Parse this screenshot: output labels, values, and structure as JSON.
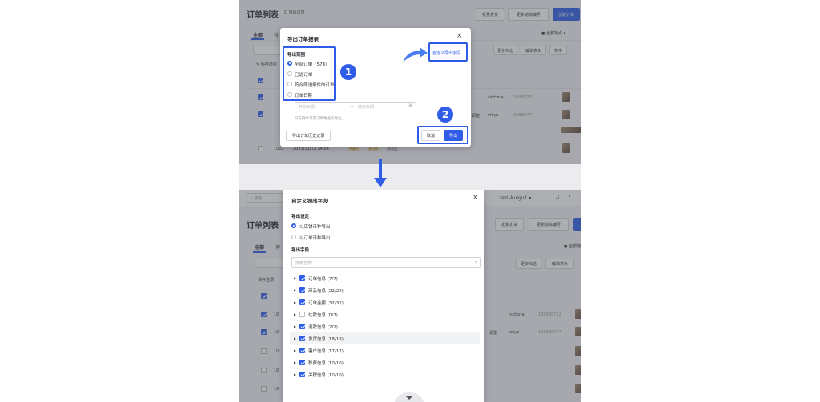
{
  "top": {
    "page_title": "订单列表",
    "export_order_label": "导出订单",
    "header_buttons": [
      "批量发货",
      "更新追踪编号",
      "创建订单"
    ],
    "tabs": [
      "全部",
      "待"
    ],
    "location": "全部地点",
    "toolbar_buttons": [
      "更多筛选",
      "编辑表头",
      "排序"
    ],
    "save_filter_label": "保存选项",
    "rows": [
      {
        "checked": true,
        "user": "victoria",
        "phone": "138885752"
      },
      {
        "checked": true,
        "status": "调整",
        "user": "miya",
        "phone": "138888777"
      },
      {
        "checked": false,
        "id": "1002",
        "date": "2023/11/21 14:56",
        "tags": [
          "待履约",
          "未付款",
          "未发货"
        ]
      }
    ],
    "modal": {
      "title": "导出订单报表",
      "scope_label": "导出范围",
      "options": [
        "全部订单（578）",
        "已选订单",
        "符合筛选条件的订单",
        "订单日期"
      ],
      "date_start": "开始日期",
      "date_end": "结束日期",
      "hint": "日支持半年内订单数据的导出。",
      "custom_fields_link": "自定义导出字段",
      "history_button": "导出订单历史记录",
      "cancel_button": "取消",
      "export_button": "导出"
    },
    "badges": [
      "1",
      "2"
    ]
  },
  "bottom": {
    "search_placeholder": "搜索",
    "store_name": "test-huigu1",
    "page_title": "订单列表",
    "tabs": [
      "全部",
      "待"
    ],
    "header_buttons": [
      "批量发货",
      "更新追踪编号"
    ],
    "location": "全部地",
    "toolbar_buttons": [
      "更多筛选",
      "编辑表头"
    ],
    "save_filter_label": "保存选项",
    "rows": [
      {
        "id": "10",
        "user": "victoria",
        "phone": "138885752"
      },
      {
        "id": "10",
        "status": "调整",
        "user": "miya",
        "phone": "138888777"
      },
      {
        "id": "10"
      },
      {
        "id": "10"
      },
      {
        "id": "10"
      }
    ],
    "modal": {
      "title": "自定义导出字段",
      "settings_label": "导出设定",
      "currency_options": [
        "以店铺币种导出",
        "以订单币种导出"
      ],
      "fields_label": "导出字段",
      "search_placeholder": "搜索名称",
      "fields": [
        {
          "label": "订单信息 (7/7)",
          "checked": true
        },
        {
          "label": "商品信息 (22/22)",
          "checked": true
        },
        {
          "label": "订单金额 (32/32)",
          "checked": true
        },
        {
          "label": "付款信息 (0/7)",
          "checked": false
        },
        {
          "label": "退款信息 (2/2)",
          "checked": true
        },
        {
          "label": "发货信息 (18/18)",
          "checked": true
        },
        {
          "label": "客户信息 (17/17)",
          "checked": true
        },
        {
          "label": "税费信息 (10/10)",
          "checked": true
        },
        {
          "label": "关税信息 (10/10)",
          "checked": true
        }
      ]
    }
  },
  "colors": {
    "accent": "#2f5de8"
  }
}
